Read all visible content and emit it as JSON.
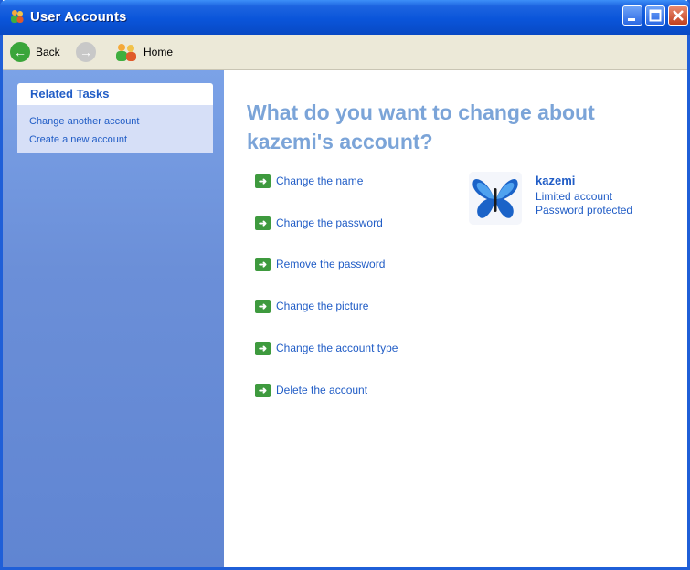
{
  "window": {
    "title": "User Accounts"
  },
  "toolbar": {
    "back_label": "Back",
    "home_label": "Home"
  },
  "sidebar": {
    "panel_title": "Related Tasks",
    "links": [
      "Change another account",
      "Create a new account"
    ]
  },
  "main": {
    "heading_line1": "What do you want to change about",
    "heading_line2": "kazemi's account?",
    "tasks": [
      "Change the name",
      "Change the password",
      "Remove the password",
      "Change the picture",
      "Change the account type",
      "Delete the account"
    ]
  },
  "account": {
    "name": "kazemi",
    "type": "Limited account",
    "status": "Password protected",
    "picture_icon": "butterfly-icon"
  },
  "colors": {
    "titlebar": "#0a55da",
    "sidebar": "#6b8fd8",
    "heading": "#7ba4d8",
    "link": "#215dc6",
    "task_arrow": "#3e9a3e"
  }
}
